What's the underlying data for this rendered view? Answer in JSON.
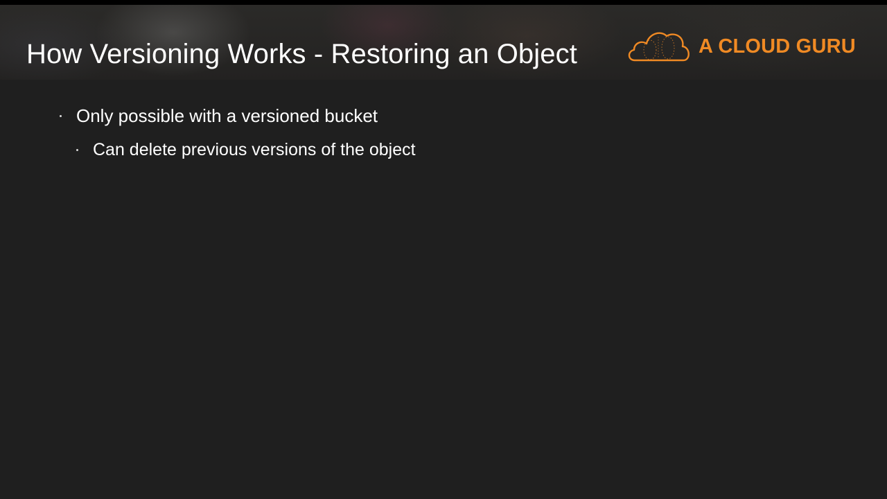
{
  "slide": {
    "title": "How Versioning Works - Restoring an Object",
    "brand": {
      "name": "A CLOUD GURU",
      "logo_icon": "cloud-guru-icon",
      "accent_color": "#f08a24"
    },
    "bullets": [
      {
        "text": "Only possible with a versioned bucket",
        "level": 1
      },
      {
        "text": "Can delete previous versions of the object",
        "level": 2
      }
    ],
    "colors": {
      "background": "#1f1f1f",
      "header_background": "#282726",
      "text": "#ffffff"
    }
  }
}
